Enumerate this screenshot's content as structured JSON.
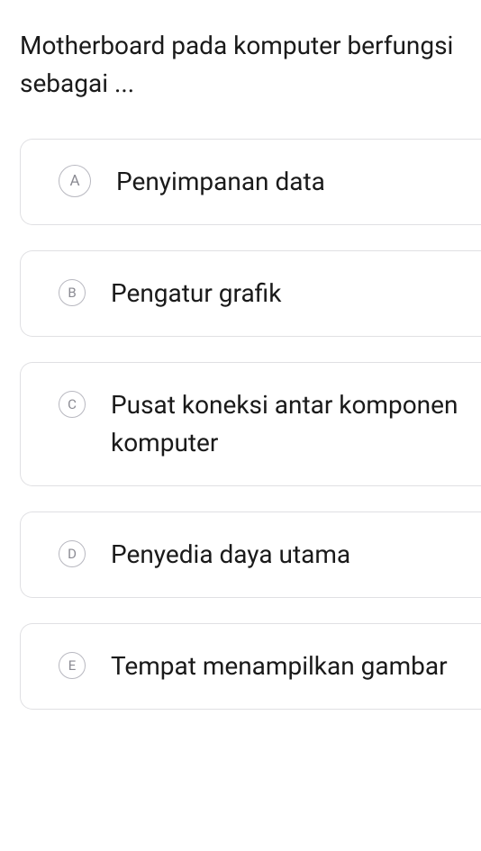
{
  "question": "Motherboard pada komputer berfungsi sebagai ...",
  "options": [
    {
      "letter": "A",
      "text": "Penyimpanan data"
    },
    {
      "letter": "B",
      "text": "Pengatur grafik"
    },
    {
      "letter": "C",
      "text": "Pusat koneksi antar komponen komputer"
    },
    {
      "letter": "D",
      "text": "Penyedia daya utama"
    },
    {
      "letter": "E",
      "text": "Tempat menampilkan gambar"
    }
  ]
}
